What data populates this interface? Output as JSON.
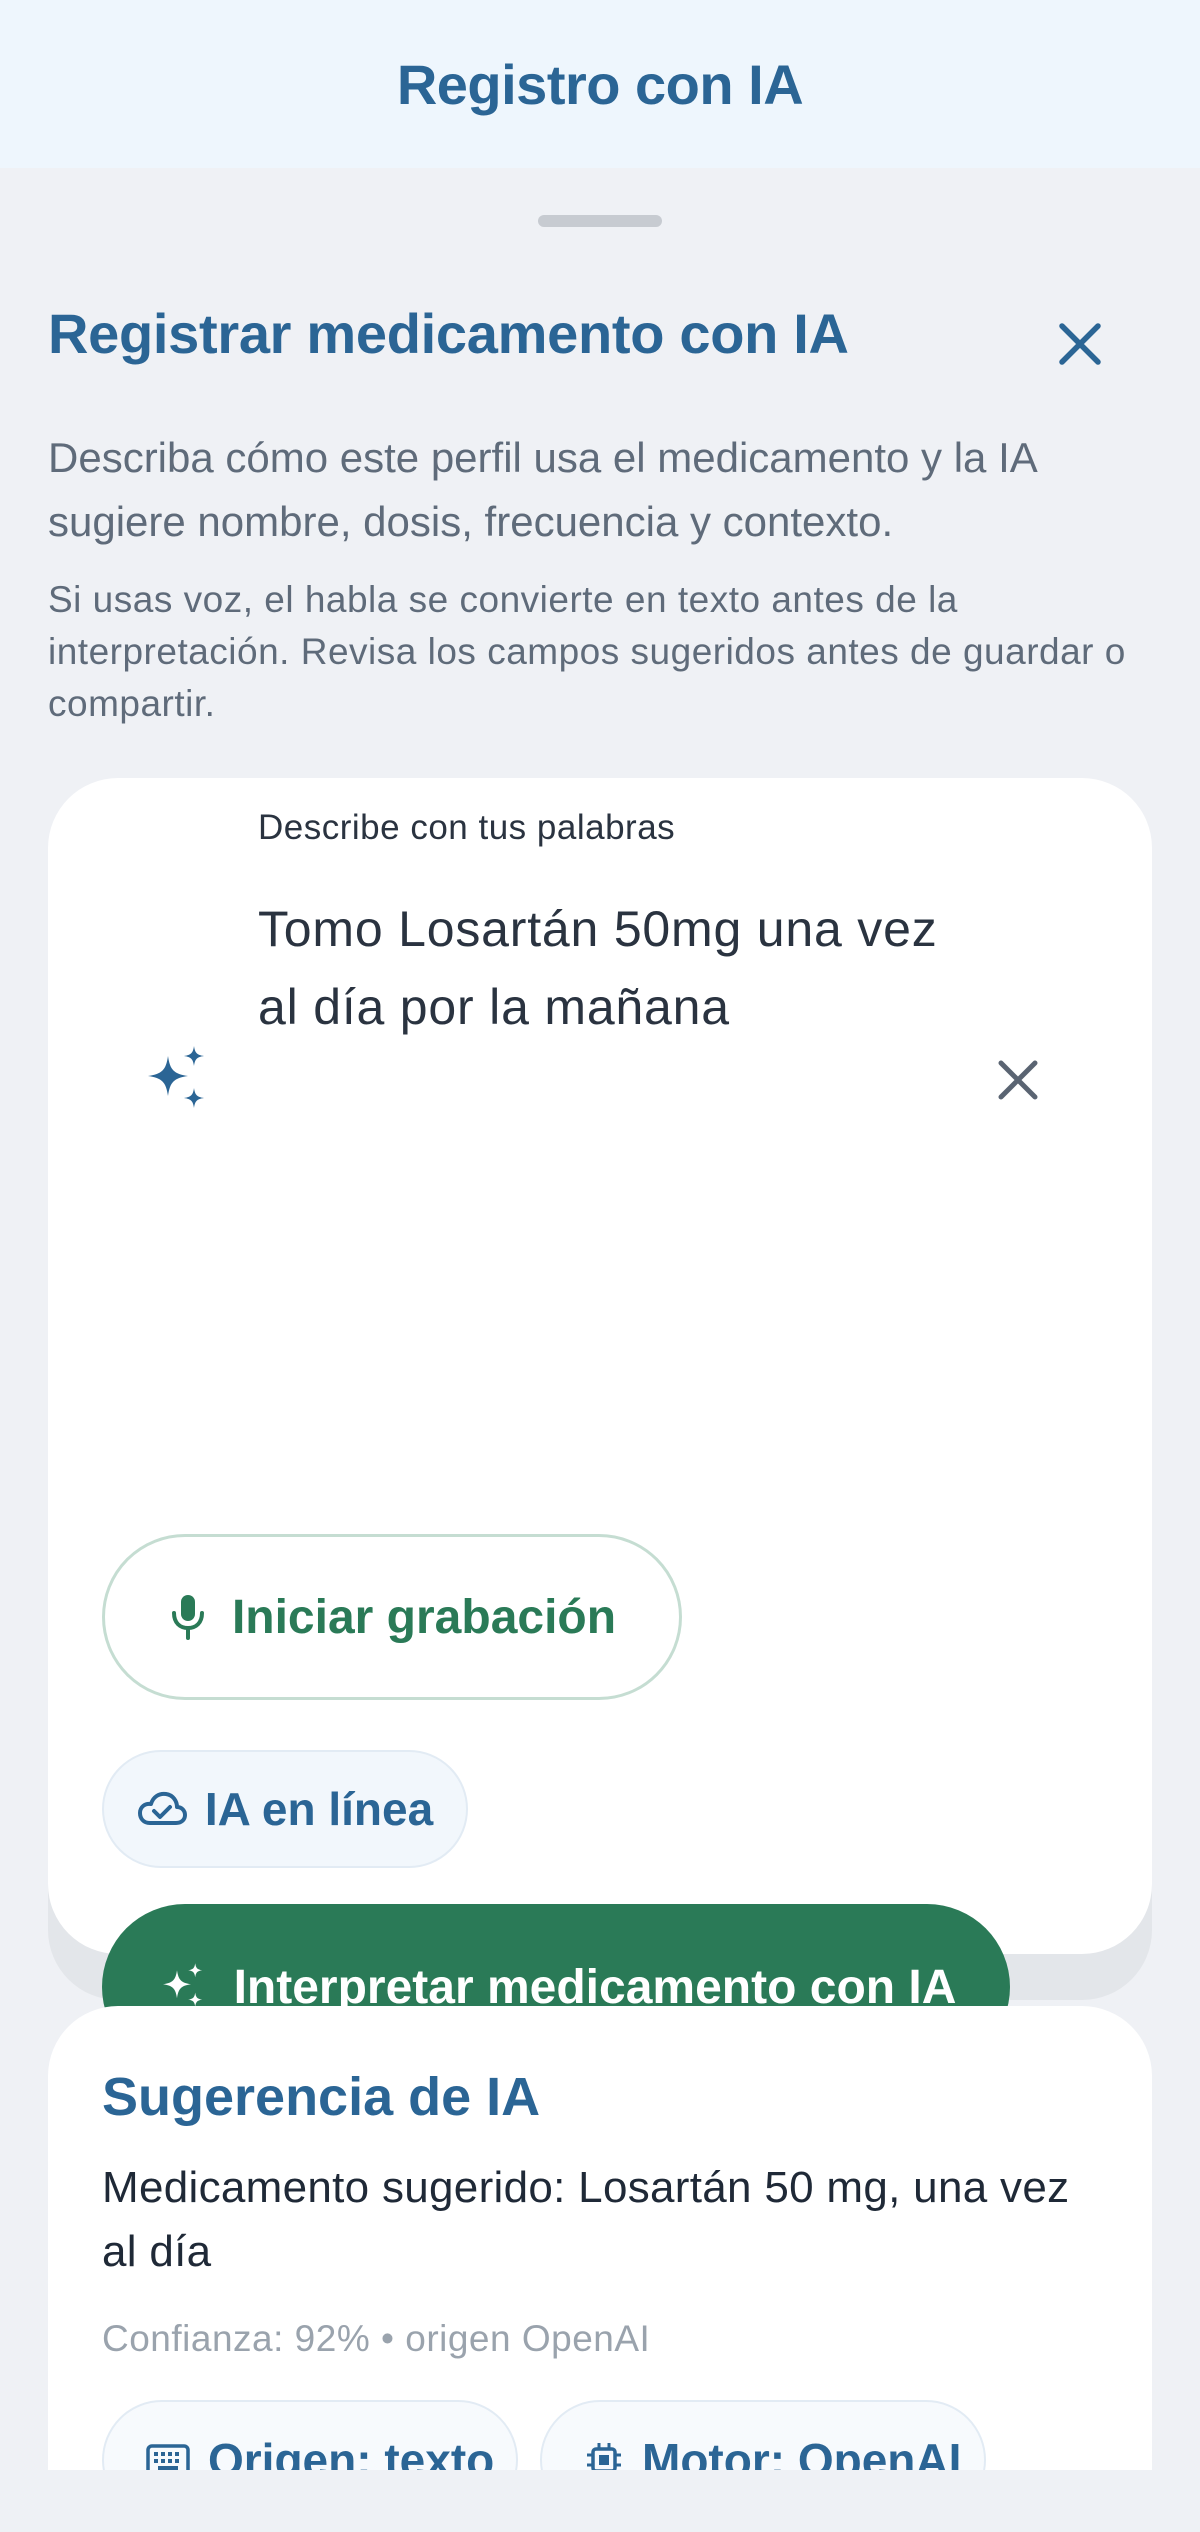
{
  "header": {
    "title": "Registro con IA"
  },
  "sheet": {
    "title": "Registrar medicamento con IA",
    "description": "Describa cómo este perfil usa el medicamento y la IA sugiere nombre, dosis, frecuencia y contexto.",
    "voice_note": "Si usas voz, el habla se convierte en texto antes de la interpretación. Revisa los campos sugeridos antes de guardar o compartir."
  },
  "input_card": {
    "field_label": "Describe con tus palabras",
    "field_value": "Tomo Losartán 50mg una vez al día por la mañana",
    "record_label": "Iniciar grabación",
    "online_chip": "IA en línea",
    "interpret_label": "Interpretar medicamento con IA"
  },
  "suggestion": {
    "title": "Sugerencia de IA",
    "text": "Medicamento sugerido: Losartán 50 mg, una vez al día",
    "confidence": "Confianza: 92% • origen OpenAI",
    "origin_chip": "Origen: texto",
    "engine_chip": "Motor: OpenAI"
  },
  "colors": {
    "brand_blue": "#2b6595",
    "brand_green": "#2a7a57",
    "header_bg": "#eef6fd",
    "sheet_bg": "#eff1f5"
  },
  "icons": {
    "close": "close-icon",
    "sparkle": "sparkle-icon",
    "clear": "clear-icon",
    "microphone": "microphone-icon",
    "cloud": "cloud-check-icon",
    "keyboard": "keyboard-icon",
    "chip": "cpu-chip-icon"
  }
}
